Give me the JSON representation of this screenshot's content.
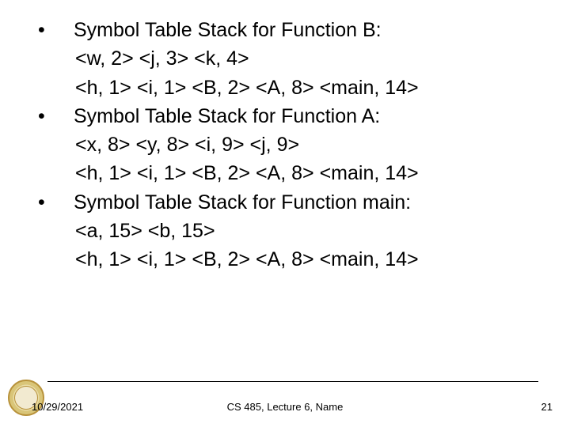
{
  "bullets": [
    {
      "head": "Symbol Table Stack for Function B:",
      "lines": [
        "<w, 2> <j, 3> <k, 4>",
        "<h, 1> <i, 1> <B, 2> <A, 8> <main, 14>"
      ]
    },
    {
      "head": "Symbol Table Stack for Function A:",
      "lines": [
        "<x, 8> <y, 8> <i, 9> <j, 9>",
        "<h, 1> <i, 1> <B, 2> <A, 8> <main, 14>"
      ]
    },
    {
      "head": "Symbol Table Stack for Function main:",
      "lines": [
        "<a, 15> <b, 15>",
        "<h, 1> <i, 1> <B, 2> <A, 8> <main, 14>"
      ]
    }
  ],
  "footer": {
    "date": "10/29/2021",
    "center": "CS 485,  Lecture 6, Name",
    "page": "21"
  },
  "bullet_char": "•"
}
